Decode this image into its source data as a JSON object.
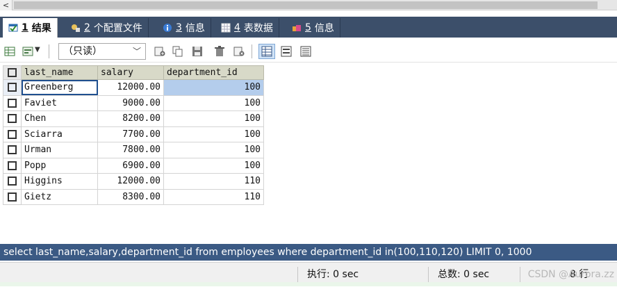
{
  "scrollbar": {
    "left_arrow": "<"
  },
  "tabs": [
    {
      "num": "1",
      "label": "结果",
      "icon": "result-table-icon",
      "active": true
    },
    {
      "num": "2",
      "label": "个配置文件",
      "icon": "profile-icon",
      "active": false
    },
    {
      "num": "3",
      "label": "信息",
      "icon": "info-icon",
      "active": false
    },
    {
      "num": "4",
      "label": "表数据",
      "icon": "table-data-icon",
      "active": false
    },
    {
      "num": "5",
      "label": "信息",
      "icon": "info-history-icon",
      "active": false
    }
  ],
  "toolbar": {
    "mode_select": "（只读）",
    "icons": [
      "export-grid-icon",
      "view-options-icon",
      "dropdown-arrow-icon",
      "insert-row-icon",
      "duplicate-row-icon",
      "save-icon",
      "delete-icon",
      "cancel-changes-icon",
      "grid-view-icon",
      "form-view-icon",
      "text-view-icon"
    ]
  },
  "grid": {
    "columns": [
      "last_name",
      "salary",
      "department_id"
    ],
    "rows": [
      {
        "last_name": "Greenberg",
        "salary": "12000.00",
        "department_id": "100"
      },
      {
        "last_name": "Faviet",
        "salary": "9000.00",
        "department_id": "100"
      },
      {
        "last_name": "Chen",
        "salary": "8200.00",
        "department_id": "100"
      },
      {
        "last_name": "Sciarra",
        "salary": "7700.00",
        "department_id": "100"
      },
      {
        "last_name": "Urman",
        "salary": "7800.00",
        "department_id": "100"
      },
      {
        "last_name": "Popp",
        "salary": "6900.00",
        "department_id": "100"
      },
      {
        "last_name": "Higgins",
        "salary": "12000.00",
        "department_id": "110"
      },
      {
        "last_name": "Gietz",
        "salary": "8300.00",
        "department_id": "110"
      }
    ]
  },
  "query": "select last_name,salary,department_id from employees where department_id in(100,110,120) LIMIT 0, 1000",
  "status": {
    "exec_label": "执行: 0 sec",
    "total_label": "总数: 0 sec",
    "rows_label": "8 行",
    "watermark": "CSDN @Aurora.zz"
  },
  "colors": {
    "tabbar": "#3c4f6a",
    "querybar": "#3b5a84",
    "header": "#d8d9c8",
    "selection": "#b4cdec"
  }
}
